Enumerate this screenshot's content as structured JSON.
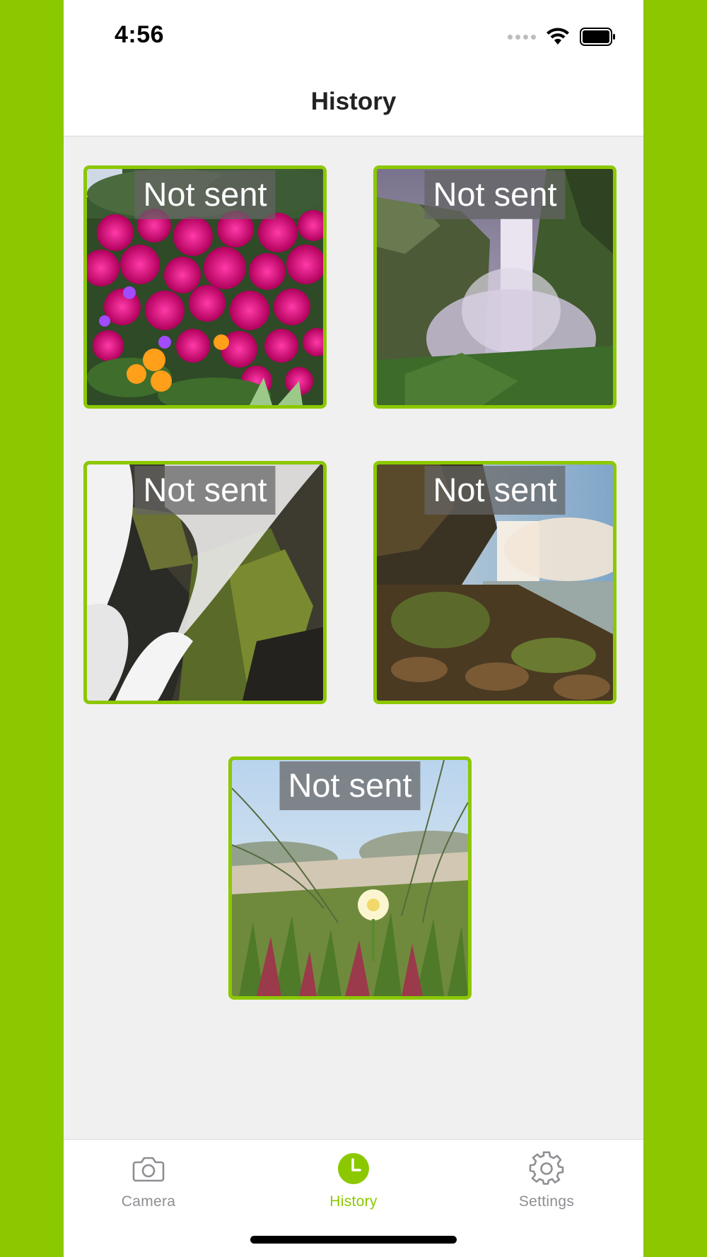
{
  "status_bar": {
    "time": "4:56",
    "icons": [
      "cellular-signal-icon",
      "wifi-icon",
      "battery-icon"
    ]
  },
  "nav": {
    "title": "History"
  },
  "history": {
    "items": [
      {
        "status": "Not sent",
        "photo": "magenta-flowers"
      },
      {
        "status": "Not sent",
        "photo": "misty-waterfall-gorge"
      },
      {
        "status": "Not sent",
        "photo": "waterfall-mossy-rocks"
      },
      {
        "status": "Not sent",
        "photo": "waterfall-river-sunset"
      },
      {
        "status": "Not sent",
        "photo": "dune-grass-white-flower"
      }
    ]
  },
  "tab_bar": {
    "tabs": [
      {
        "label": "Camera",
        "icon": "camera-icon",
        "active": false
      },
      {
        "label": "History",
        "icon": "clock-icon",
        "active": true
      },
      {
        "label": "Settings",
        "icon": "gear-icon",
        "active": false
      }
    ]
  },
  "colors": {
    "accent": "#8CC800",
    "inactive": "#8E8E93",
    "badge_bg": "#646464",
    "content_bg": "#F0F0F0"
  }
}
